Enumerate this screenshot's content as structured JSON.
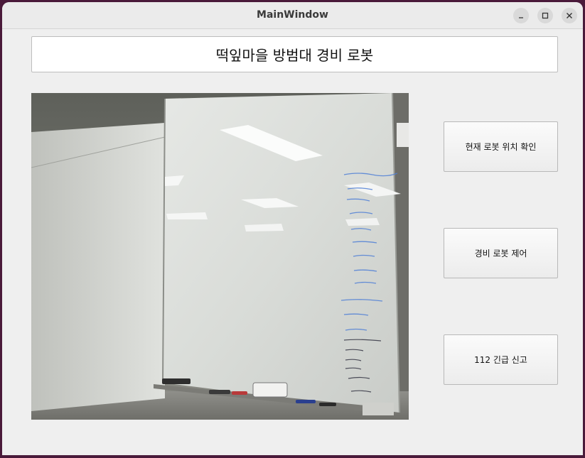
{
  "window": {
    "title": "MainWindow"
  },
  "header": {
    "title": "떡잎마을 방범대 경비 로봇"
  },
  "buttons": {
    "location": "현재 로봇 위치 확인",
    "control": "경비 로봇 제어",
    "emergency": "112 긴급 신고"
  },
  "camera": {
    "description_icon": "camera-feed"
  }
}
